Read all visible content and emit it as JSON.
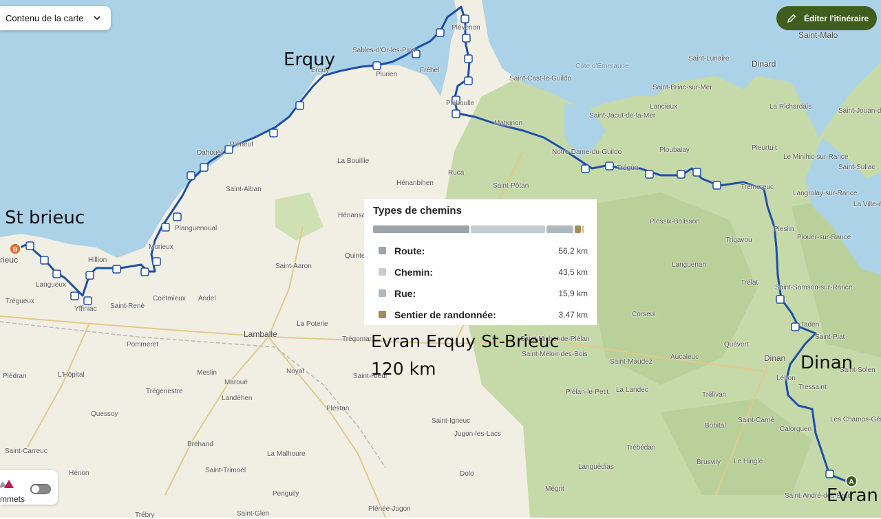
{
  "controls": {
    "map_content_label": "Contenu de la carte",
    "edit_route_label": "Éditer l'itinéraire",
    "toggle_label": "mmets"
  },
  "path_types": {
    "title": "Types de chemins",
    "rows": [
      {
        "label": "Route:",
        "value": "56,2 km",
        "color": "#9da4ab"
      },
      {
        "label": "Chemin:",
        "value": "43,5 km",
        "color": "#c5ccd3"
      },
      {
        "label": "Rue:",
        "value": "15,9 km",
        "color": "#b0b8c0"
      },
      {
        "label": "Sentier de randonnée:",
        "value": "3,47 km",
        "color": "#a38a61"
      }
    ]
  },
  "annotations": {
    "erquy": "Erquy",
    "st_brieuc": "St brieuc",
    "route_line1": "Evran Erquy  St-Brieuc",
    "route_line2": "120 km",
    "dinan": "Dinan",
    "evran": "Evran"
  },
  "markers": {
    "start": "A",
    "end": "B"
  },
  "places": {
    "saint_malo": "Saint-Malo",
    "dinard": "Dinard",
    "saint_lunaire": "Saint-Lunaire",
    "cote_emeraude": "Côte d'Émeraude",
    "saint_cast": "Saint-Cast-le-Guildo",
    "saint_briac": "Saint-Briac-sur-Mer",
    "lancieux": "Lancieux",
    "la_richardais": "La Richardais",
    "saint_jouan": "Saint-Jouan-des-Guérets",
    "saint_jacut": "Saint-Jacut-de-la-Mer",
    "matignon": "Matignon",
    "plevenon": "Plévenon",
    "frehel": "Fréhel",
    "sables": "Sables-d'Or-les-Pins",
    "plurien": "Plurien",
    "erquy_town": "Erquy",
    "plebouille": "Pléboulle",
    "notre_dame": "Notre-Dame-du-Guildo",
    "ploubalay": "Ploubalay",
    "pleurtuit": "Pleurtuit",
    "le_minihic": "Le Minihic-sur-Rance",
    "saint_suliac": "Saint-Suliac",
    "langrolay": "Langrolay-sur-Rance",
    "la_ville_es": "La Ville-ès",
    "tregon": "Trégon",
    "tremereuc": "Trémereuc",
    "pleslin": "Pleslin",
    "plouer": "Plouër-sur-Rance",
    "plessix": "Plessix-Balisson",
    "trigavou": "Trigavou",
    "languenan": "Languenan",
    "trelat": "Trélat",
    "saint_samson": "Saint-Samson-sur-Rance",
    "taden": "Taden",
    "saint_piat": "Saint-Piat",
    "corseul": "Corseul",
    "quevert": "Quévert",
    "dinan_town": "Dinan",
    "lehon": "Léhon",
    "tressaint": "Tressaint",
    "aucaleuc": "Aucaleuc",
    "saint_solen": "Saint-Solen",
    "les_champs": "Les Champs-Géraux",
    "calorguen": "Calorguen",
    "saint_carne": "Saint-Carné",
    "trelivan": "Trélivan",
    "la_landec": "La Landec",
    "bobital": "Bobital",
    "brusvily": "Brusvily",
    "le_hingle": "Le Hinglé",
    "trebedan": "Trébédan",
    "languedias": "Languédias",
    "megrit": "Mégrit",
    "saint_andre": "Saint-André-des-Eaux",
    "pleneuf": "Pléneuf",
    "dahouet": "Dahouët",
    "la_bouillie": "La Bouillie",
    "ruca": "Ruca",
    "henanbihen": "Hénanbihen",
    "saint_potan": "Saint-Pôtan",
    "saint_alban": "Saint-Alban",
    "henansal": "Hénansal",
    "quintenic": "Quintenic",
    "planguenoual": "Planguenoual",
    "morieux": "Morieux",
    "hillion": "Hillion",
    "langueux": "Langueux",
    "tregueux": "Trégueux",
    "yffiniac": "Yffiniac",
    "saint_rene": "Saint-René",
    "coetmieux": "Coëtmieux",
    "andel": "Andel",
    "saint_aaron": "Saint-Aaron",
    "la_poterie": "La Poterie",
    "lamballe": "Lamballe",
    "tregomar": "Trégomar",
    "pommeret": "Pommeret",
    "noyal": "Noyal",
    "meslin": "Meslin",
    "maroue": "Maroué",
    "landehen": "Landéhen",
    "saint_rieul": "Saint-Rieul",
    "lhopital": "L'Hôpital",
    "pledran": "Plédran",
    "tregenestre": "Trégenestre",
    "plestan": "Plestan",
    "quessoy": "Quessoy",
    "saint_igneuc": "Saint-Igneuc",
    "jugon": "Jugon-les-Lacs",
    "saint_michel": "Saint-Michel-de-Plélan",
    "saint_meloir": "Saint-Méloir-des-Bois",
    "saint_maudez": "Saint-Maudez",
    "plelan": "Plélan-le-Petit",
    "saint_carreuc": "Saint-Carreuc",
    "henon": "Hénon",
    "brehand": "Bréhand",
    "la_malhoure": "La Malhoure",
    "saint_trimoel": "Saint-Trimoël",
    "penguily": "Penguily",
    "dolo": "Dolo",
    "plenee": "Plénée-Jugon",
    "saint_glen": "Saint-Glen",
    "trebry": "Trébry",
    "brieuc": "rieuc"
  },
  "colors": {
    "route": "#1d4fa8",
    "land": "#f1eee4",
    "sea": "#abd2e6",
    "forest": "#b8d19d"
  }
}
